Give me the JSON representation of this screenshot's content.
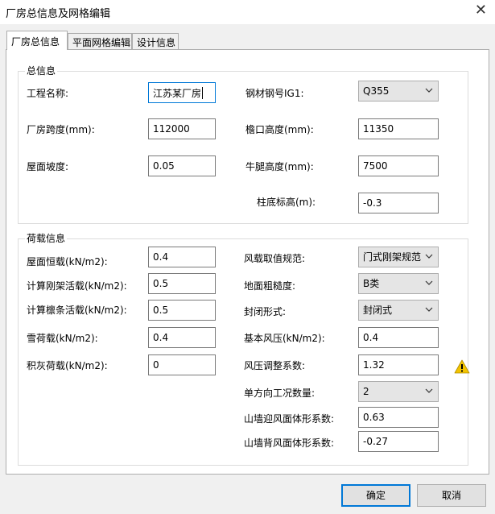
{
  "window": {
    "title": "厂房总信息及网格编辑",
    "close_glyph": "✕"
  },
  "tabs": [
    {
      "label": "厂房总信息",
      "active": true
    },
    {
      "label": "平面网格编辑",
      "active": false
    },
    {
      "label": "设计信息",
      "active": false
    }
  ],
  "general": {
    "legend": "总信息",
    "project_name": {
      "label": "工程名称:",
      "value": "江苏某厂房"
    },
    "steel_grade": {
      "label": "钢材钢号IG1:",
      "value": "Q355"
    },
    "span": {
      "label": "厂房跨度(mm):",
      "value": "112000"
    },
    "eave_height": {
      "label": "檐口高度(mm):",
      "value": "11350"
    },
    "roof_slope": {
      "label": "屋面坡度:",
      "value": "0.05"
    },
    "corbel_height": {
      "label": "牛腿高度(mm):",
      "value": "7500"
    },
    "column_base": {
      "label": "柱底标高(m):",
      "value": "-0.3"
    }
  },
  "loads": {
    "legend": "荷载信息",
    "roof_dead": {
      "label": "屋面恒载(kN/m2):",
      "value": "0.4"
    },
    "frame_live": {
      "label": "计算刚架活载(kN/m2):",
      "value": "0.5"
    },
    "purlin_live": {
      "label": "计算檩条活载(kN/m2):",
      "value": "0.5"
    },
    "snow": {
      "label": "雪荷载(kN/m2):",
      "value": "0.4"
    },
    "ash": {
      "label": "积灰荷载(kN/m2):",
      "value": "0"
    },
    "wind_code": {
      "label": "风载取值规范:",
      "value": "门式刚架规范"
    },
    "roughness": {
      "label": "地面粗糙度:",
      "value": "B类"
    },
    "enclosure": {
      "label": "封闭形式:",
      "value": "封闭式"
    },
    "basic_wind": {
      "label": "基本风压(kN/m2):",
      "value": "0.4"
    },
    "wind_adjust": {
      "label": "风压调整系数:",
      "value": "1.32"
    },
    "case_count": {
      "label": "单方向工况数量:",
      "value": "2"
    },
    "gable_windward": {
      "label": "山墙迎风面体形系数:",
      "value": "0.63"
    },
    "gable_leeward": {
      "label": "山墙背风面体形系数:",
      "value": "-0.27"
    }
  },
  "buttons": {
    "ok": "确定",
    "cancel": "取消"
  },
  "colors": {
    "accent": "#0078d7",
    "warning": "#f2c300"
  },
  "icons": {
    "warning": "warning-icon",
    "dropdown": "chevron-down-icon"
  }
}
